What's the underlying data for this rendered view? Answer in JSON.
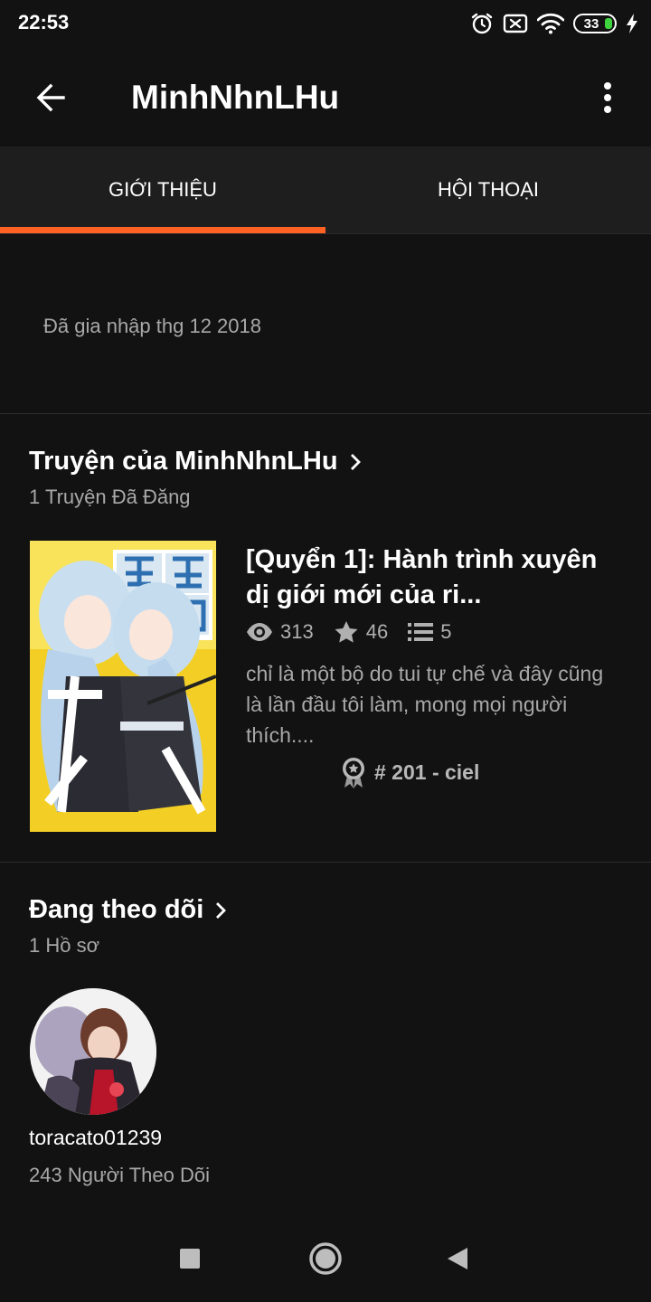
{
  "status_bar": {
    "time": "22:53",
    "battery_level": "33",
    "icons": [
      "alarm-icon",
      "no-sim-icon",
      "wifi-icon",
      "battery-icon",
      "charging-icon"
    ]
  },
  "app_bar": {
    "title": "MinhNhnLHu",
    "back_icon": "arrow-back-icon",
    "menu_icon": "more-vert-icon"
  },
  "tabs": [
    {
      "label": "GIỚI THIỆU",
      "active": true
    },
    {
      "label": "HỘI THOẠI",
      "active": false
    }
  ],
  "about": {
    "joined": "Đã gia nhập thg 12 2018"
  },
  "stories_section": {
    "title": "Truyện của MinhNhnLHu",
    "subtitle": "1 Truyện Đã Đăng",
    "items": [
      {
        "title": "[Quyển 1]: Hành trình xuyên dị giới mới của ri...",
        "views": "313",
        "votes": "46",
        "parts": "5",
        "description": "chỉ là một bộ do tui tự chế và đây cũng là lần đầu tôi làm, mong mọi người thích....",
        "rank": "# 201 - ciel"
      }
    ]
  },
  "following_section": {
    "title": "Đang theo dõi",
    "subtitle": "1 Hồ sơ",
    "profiles": [
      {
        "username": "toracato01239",
        "followers": "243 Người Theo Dõi"
      }
    ]
  },
  "colors": {
    "accent": "#ff6122",
    "background": "#121212",
    "tab_background": "#1e1e1e",
    "muted_text": "#a8a8a8"
  }
}
